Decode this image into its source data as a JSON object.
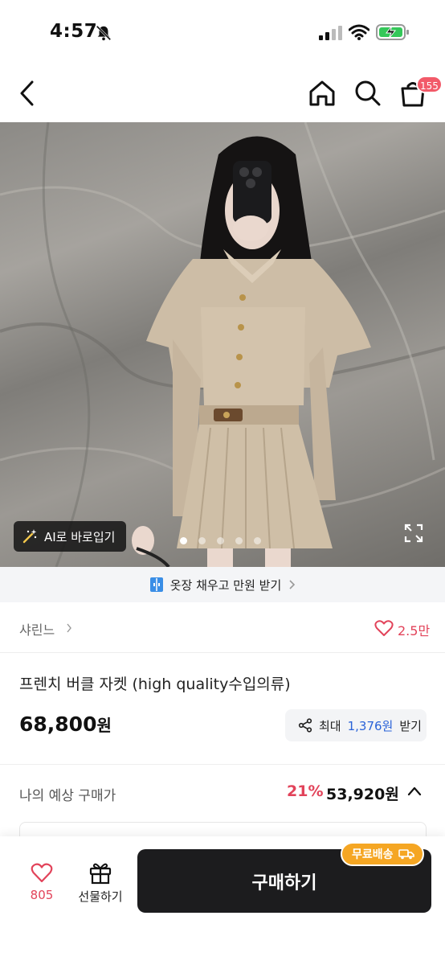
{
  "status_bar": {
    "time": "4:57"
  },
  "header": {
    "cart_count": "155"
  },
  "hero": {
    "ai_button_label": "AI로 바로입기",
    "total_images": 5,
    "active_image": 1
  },
  "promo": {
    "text": "옷장 채우고 만원 받기"
  },
  "brand": {
    "name": "샤린느",
    "like_count": "2.5만"
  },
  "product": {
    "title": "프렌치 버클 자켓 (high quality수입의류)",
    "price": "68,800",
    "price_unit": "원",
    "reward_prefix": "최대",
    "reward_amount": "1,376원",
    "reward_suffix": "받기"
  },
  "expected_price": {
    "label": "나의 예상 구매가",
    "discount": "21%",
    "price": "53,920원"
  },
  "bottom_bar": {
    "wish_count": "805",
    "gift_label": "선물하기",
    "buy_label": "구매하기",
    "free_shipping_label": "무료배송"
  },
  "colors": {
    "accent_red": "#e2435a",
    "reward_blue": "#2a63d8",
    "shipping_orange": "#f5a623",
    "buy_button": "#1c1c1e"
  }
}
